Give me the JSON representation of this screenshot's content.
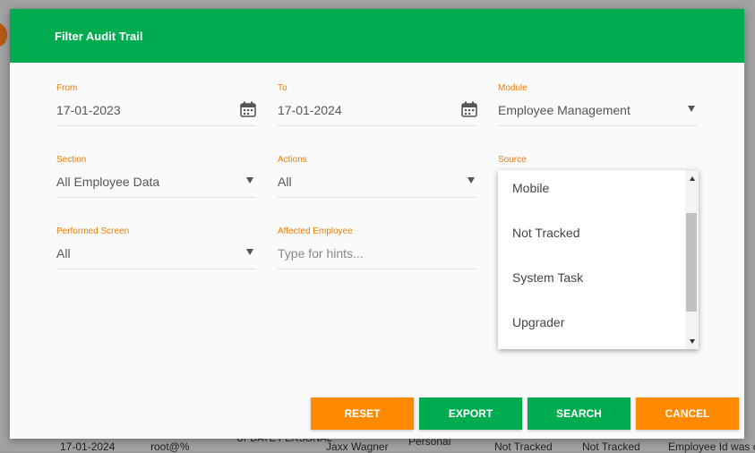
{
  "modal": {
    "title": "Filter Audit Trail"
  },
  "fields": {
    "from": {
      "label": "From",
      "value": "17-01-2023"
    },
    "to": {
      "label": "To",
      "value": "17-01-2024"
    },
    "module": {
      "label": "Module",
      "value": "Employee Management"
    },
    "section": {
      "label": "Section",
      "value": "All Employee Data"
    },
    "actions": {
      "label": "Actions",
      "value": "All"
    },
    "source": {
      "label": "Source"
    },
    "performed_screen": {
      "label": "Performed Screen",
      "value": "All"
    },
    "affected_employee": {
      "label": "Affected Employee",
      "placeholder": "Type for hints..."
    }
  },
  "source_dropdown": {
    "options": [
      "Mobile",
      "Not Tracked",
      "System Task",
      "Upgrader"
    ]
  },
  "buttons": {
    "reset": "RESET",
    "export": "EXPORT",
    "search": "SEARCH",
    "cancel": "CANCEL"
  },
  "background": {
    "row": {
      "date": "17-01-2024",
      "user": "root@%",
      "action": "UPDATE PERSONAL",
      "employee": "Jaxx Wagner",
      "section": "Personal",
      "source1": "Not Tracked",
      "source2": "Not Tracked",
      "detail": "Employee Id was c"
    }
  },
  "colors": {
    "header_green": "#00ac4f",
    "label_orange": "#f07d00",
    "button_orange": "#ff8a00",
    "button_green": "#00ac4f"
  },
  "icons": {
    "calendar": "calendar-icon",
    "dropdown": "chevron-down-icon"
  }
}
